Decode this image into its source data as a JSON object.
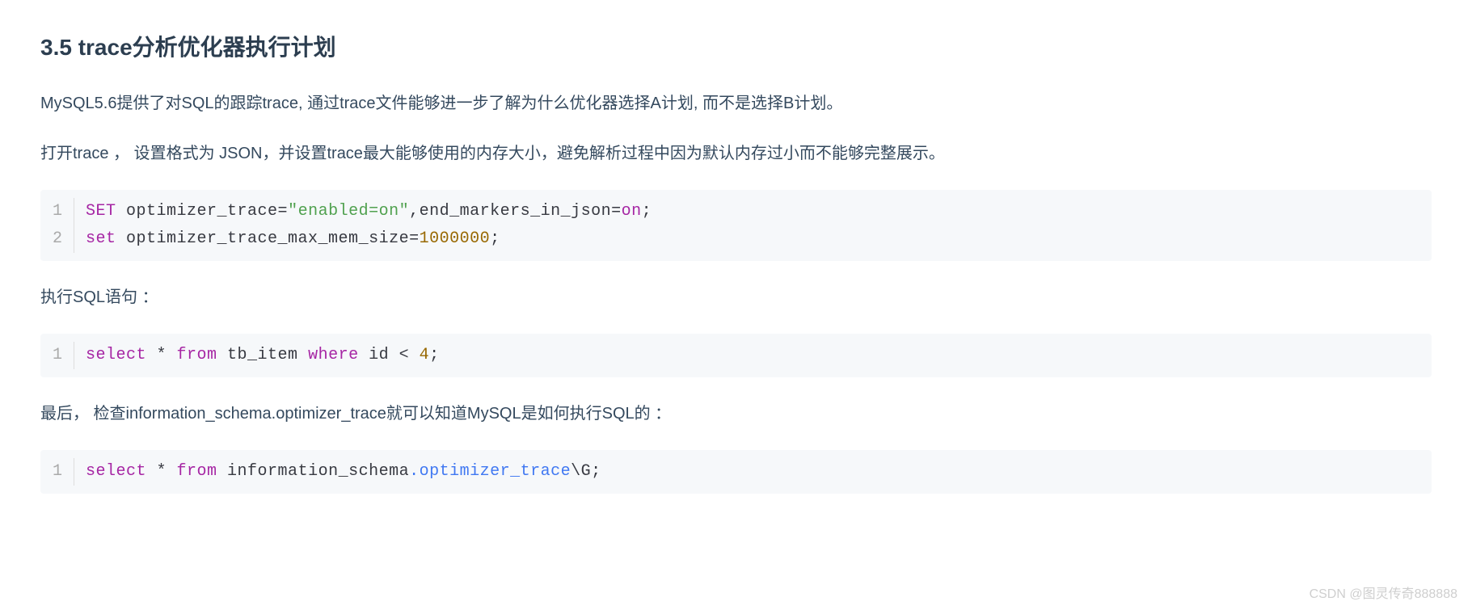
{
  "heading": "3.5 trace分析优化器执行计划",
  "paragraphs": {
    "p1": "MySQL5.6提供了对SQL的跟踪trace, 通过trace文件能够进一步了解为什么优化器选择A计划, 而不是选择B计划。",
    "p2": "打开trace ， 设置格式为 JSON，并设置trace最大能够使用的内存大小，避免解析过程中因为默认内存过小而不能够完整展示。",
    "p3": "执行SQL语句 ：",
    "p4": "最后， 检查information_schema.optimizer_trace就可以知道MySQL是如何执行SQL的 ："
  },
  "code1": {
    "line1": {
      "no": "1",
      "tokens": {
        "t1": "SET",
        "t2": " optimizer_trace=",
        "t3": "\"enabled=on\"",
        "t4": ",end_markers_in_json=",
        "t5": "on",
        "t6": ";"
      }
    },
    "line2": {
      "no": "2",
      "tokens": {
        "t1": "set",
        "t2": " optimizer_trace_max_mem_size=",
        "t3": "1000000",
        "t4": ";"
      }
    }
  },
  "code2": {
    "line1": {
      "no": "1",
      "tokens": {
        "t1": "select",
        "t2": " * ",
        "t3": "from",
        "t4": " tb_item ",
        "t5": "where",
        "t6": " id < ",
        "t7": "4",
        "t8": ";"
      }
    }
  },
  "code3": {
    "line1": {
      "no": "1",
      "tokens": {
        "t1": "select",
        "t2": " * ",
        "t3": "from",
        "t4": " information_schema",
        "t5": ".optimizer_trace",
        "t6": "\\G;"
      }
    }
  },
  "watermark": "CSDN @图灵传奇888888"
}
